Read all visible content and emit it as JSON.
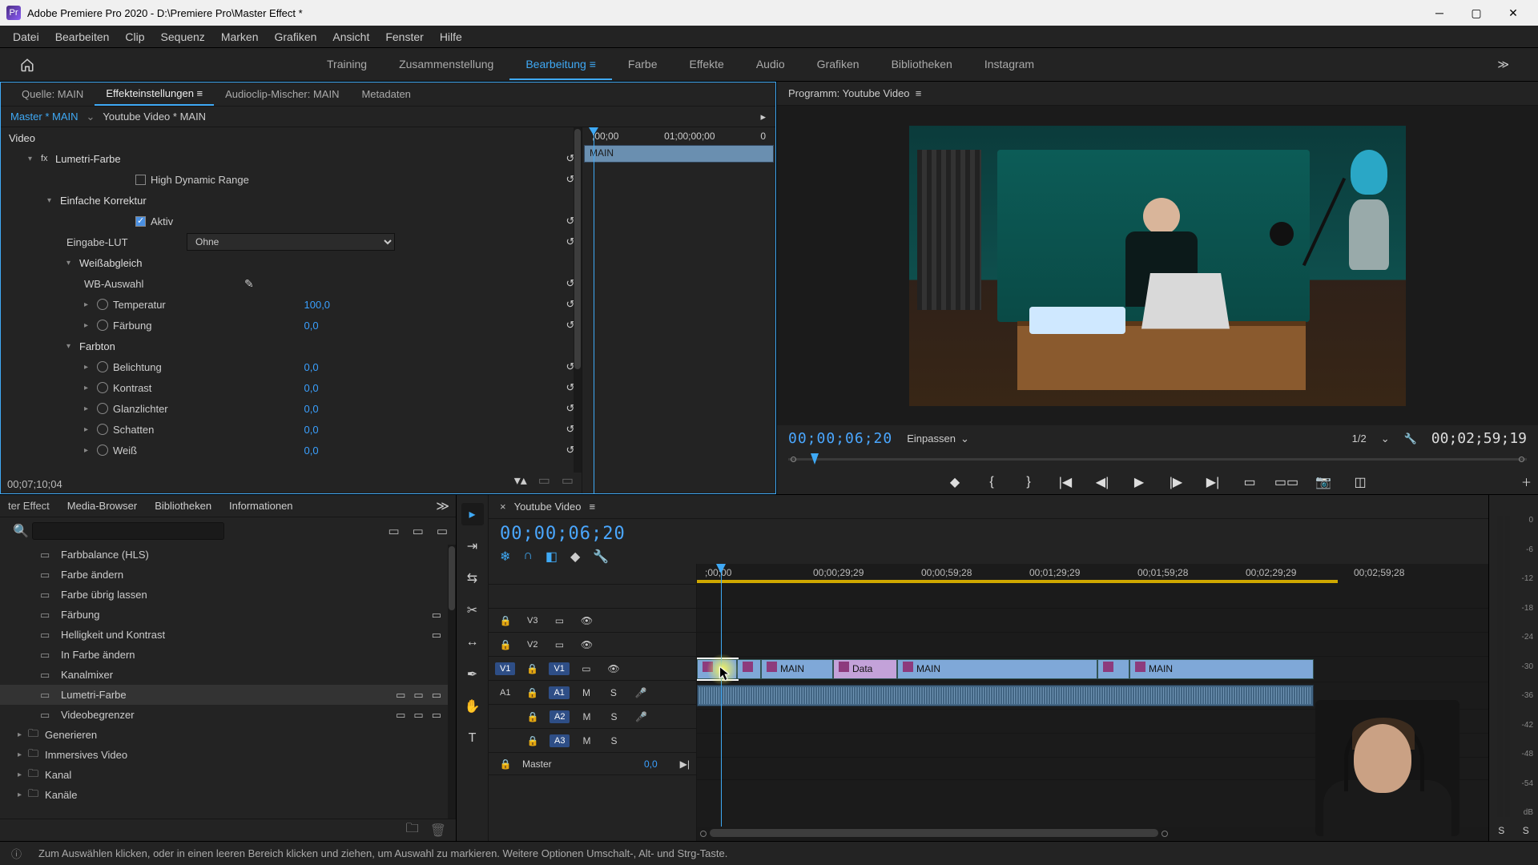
{
  "titlebar": {
    "app": "Adobe Premiere Pro 2020",
    "project": "D:\\Premiere Pro\\Master Effect *"
  },
  "menu": [
    "Datei",
    "Bearbeiten",
    "Clip",
    "Sequenz",
    "Marken",
    "Grafiken",
    "Ansicht",
    "Fenster",
    "Hilfe"
  ],
  "workspaces": {
    "items": [
      "Training",
      "Zusammenstellung",
      "Bearbeitung",
      "Farbe",
      "Effekte",
      "Audio",
      "Grafiken",
      "Bibliotheken",
      "Instagram"
    ],
    "active": "Bearbeitung"
  },
  "source_tabs": {
    "items": [
      "Quelle: MAIN",
      "Effekteinstellungen",
      "Audioclip-Mischer: MAIN",
      "Metadaten"
    ],
    "active": "Effekteinstellungen"
  },
  "ec": {
    "master": "Master * MAIN",
    "seq": "Youtube Video * MAIN",
    "timeline": {
      "start": ";00;00",
      "mid": "01;00;00;00",
      "end": "0",
      "clip": "MAIN"
    },
    "section_video": "Video",
    "effect": "Lumetri-Farbe",
    "hdr": "High Dynamic Range",
    "basic": "Einfache Korrektur",
    "active": "Aktiv",
    "lut_label": "Eingabe-LUT",
    "lut_value": "Ohne",
    "wb": "Weißabgleich",
    "wb_pick": "WB-Auswahl",
    "props": [
      {
        "name": "Temperatur",
        "val": "100,0"
      },
      {
        "name": "Färbung",
        "val": "0,0"
      }
    ],
    "tone": "Farbton",
    "tone_props": [
      {
        "name": "Belichtung",
        "val": "0,0"
      },
      {
        "name": "Kontrast",
        "val": "0,0"
      },
      {
        "name": "Glanzlichter",
        "val": "0,0"
      },
      {
        "name": "Schatten",
        "val": "0,0"
      },
      {
        "name": "Weiß",
        "val": "0,0"
      }
    ],
    "tc": "00;07;10;04"
  },
  "program": {
    "title": "Programm: Youtube Video",
    "tc": "00;00;06;20",
    "fit": "Einpassen",
    "res": "1/2",
    "dur": "00;02;59;19"
  },
  "project_tabs": [
    "ter Effect",
    "Media-Browser",
    "Bibliotheken",
    "Informationen"
  ],
  "effects_list": [
    {
      "name": "Farbbalance (HLS)"
    },
    {
      "name": "Farbe ändern"
    },
    {
      "name": "Farbe übrig lassen"
    },
    {
      "name": "Färbung",
      "badges": [
        "accel"
      ]
    },
    {
      "name": "Helligkeit und Kontrast",
      "badges": [
        "accel"
      ]
    },
    {
      "name": "In Farbe ändern"
    },
    {
      "name": "Kanalmixer"
    },
    {
      "name": "Lumetri-Farbe",
      "badges": [
        "cc",
        "accel",
        "vr"
      ],
      "sel": true
    },
    {
      "name": "Videobegrenzer",
      "badges": [
        "cc",
        "accel",
        "vr"
      ]
    }
  ],
  "effects_folders": [
    "Generieren",
    "Immersives Video",
    "Kanal",
    "Kanäle"
  ],
  "timeline": {
    "title": "Youtube Video",
    "tc": "00;00;06;20",
    "ruler": [
      ";00;00",
      "00;00;29;29",
      "00;00;59;28",
      "00;01;29;29",
      "00;01;59;28",
      "00;02;29;29",
      "00;02;59;28"
    ],
    "tracks": {
      "v3": "V3",
      "v2": "V2",
      "v1": "V1",
      "a1": "A1",
      "a2": "A2",
      "a3": "A3",
      "src_v": "V1",
      "src_a": "A1",
      "master": "Master",
      "master_val": "0,0"
    },
    "clips_v1": [
      {
        "label": "",
        "start": 0,
        "end": 50,
        "sel": true
      },
      {
        "label": "",
        "start": 50,
        "end": 80
      },
      {
        "label": "MAIN",
        "start": 80,
        "end": 170
      },
      {
        "label": "Data",
        "start": 170,
        "end": 250,
        "purple": true
      },
      {
        "label": "MAIN",
        "start": 250,
        "end": 500
      },
      {
        "label": "",
        "start": 500,
        "end": 540
      },
      {
        "label": "MAIN",
        "start": 540,
        "end": 770
      }
    ],
    "aclip": {
      "start": 0,
      "end": 770
    }
  },
  "meters_db": [
    "0",
    "-6",
    "-12",
    "-18",
    "-24",
    "-30",
    "-36",
    "-42",
    "-48",
    "-54",
    "dB"
  ],
  "status": {
    "text": "Zum Auswählen klicken, oder in einen leeren Bereich klicken und ziehen, um Auswahl zu markieren. Weitere Optionen Umschalt-, Alt- und Strg-Taste."
  }
}
